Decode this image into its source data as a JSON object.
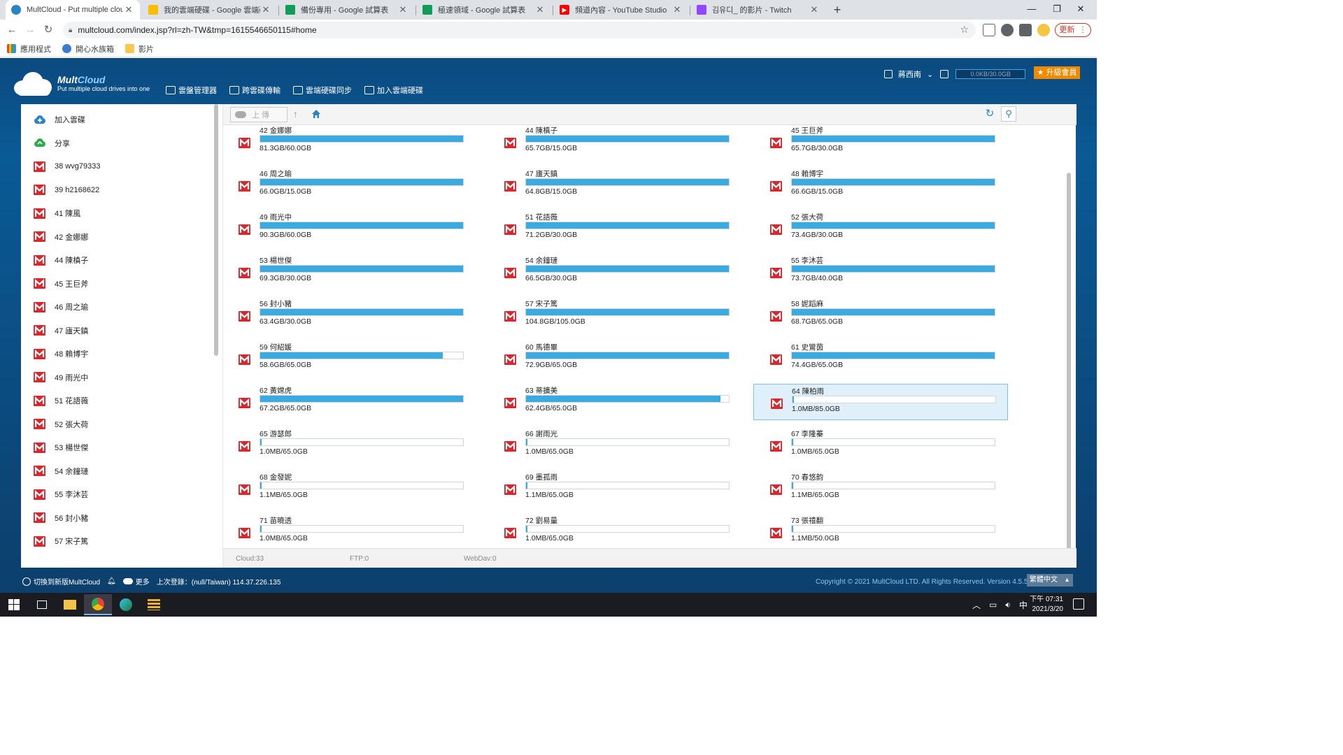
{
  "browser": {
    "tabs": [
      {
        "title": "MultCloud - Put multiple cloud",
        "color": "#2a84c5",
        "active": true
      },
      {
        "title": "我的雲端硬碟 - Google 雲端硬碟",
        "color": "#fbbc04"
      },
      {
        "title": "備份專用 - Google 試算表",
        "color": "#0f9d58"
      },
      {
        "title": "極速領域 - Google 試算表",
        "color": "#0f9d58"
      },
      {
        "title": "頻道內容 - YouTube Studio",
        "color": "#ff0000"
      },
      {
        "title": "김유디_ 的影片 - Twitch",
        "color": "#9146ff"
      }
    ],
    "url": "multcloud.com/index.jsp?rl=zh-TW&tmp=1615546650115#home",
    "update_label": "更新",
    "bookmarks": [
      {
        "label": "應用程式",
        "color": "#4285f4"
      },
      {
        "label": "開心水族箱",
        "color": "#3a7bd5"
      },
      {
        "label": "影片",
        "color": "#f9c74f"
      }
    ]
  },
  "app": {
    "brand_a": "Mult",
    "brand_b": "Cloud",
    "tagline": "Put multiple cloud drives into one",
    "nav": [
      "雲盤管理器",
      "跨雲碟傳輸",
      "雲端硬碟同步",
      "加入雲端硬碟"
    ],
    "user": "蔣西南",
    "quota": "0.0KB/30.0GB",
    "upgrade": "★ 升級會員",
    "toolbar": {
      "upload": "上 傳"
    },
    "sidebar": [
      {
        "label": "加入雲碟",
        "icon": "add-cloud"
      },
      {
        "label": "分享",
        "icon": "share-cloud"
      },
      {
        "label": "38 wvg79333",
        "icon": "mega"
      },
      {
        "label": "39 h2168622",
        "icon": "mega"
      },
      {
        "label": "41 陳風",
        "icon": "mega"
      },
      {
        "label": "42 金娜娜",
        "icon": "mega"
      },
      {
        "label": "44 陳槙子",
        "icon": "mega"
      },
      {
        "label": "45 王巨斧",
        "icon": "mega"
      },
      {
        "label": "46 周之瑜",
        "icon": "mega"
      },
      {
        "label": "47 廬天鎮",
        "icon": "mega"
      },
      {
        "label": "48 賴博宇",
        "icon": "mega"
      },
      {
        "label": "49 雨光中",
        "icon": "mega"
      },
      {
        "label": "51 花語薇",
        "icon": "mega"
      },
      {
        "label": "52 張大荷",
        "icon": "mega"
      },
      {
        "label": "53 楊世傑",
        "icon": "mega"
      },
      {
        "label": "54 余鐘璉",
        "icon": "mega"
      },
      {
        "label": "55 李沐芸",
        "icon": "mega"
      },
      {
        "label": "56 封小豬",
        "icon": "mega"
      },
      {
        "label": "57 宋子篤",
        "icon": "mega"
      }
    ],
    "drives": [
      {
        "name": "42 金娜娜",
        "size": "81.3GB/60.0GB",
        "used": 1.0
      },
      {
        "name": "44 陳槙子",
        "size": "65.7GB/15.0GB",
        "used": 1.0
      },
      {
        "name": "45 王巨斧",
        "size": "65.7GB/30.0GB",
        "used": 1.0
      },
      {
        "name": "46 周之瑜",
        "size": "66.0GB/15.0GB",
        "used": 1.0
      },
      {
        "name": "47 廬天鎮",
        "size": "64.8GB/15.0GB",
        "used": 1.0
      },
      {
        "name": "48 賴博宇",
        "size": "66.6GB/15.0GB",
        "used": 1.0
      },
      {
        "name": "49 雨光中",
        "size": "90.3GB/60.0GB",
        "used": 1.0
      },
      {
        "name": "51 花語薇",
        "size": "71.2GB/30.0GB",
        "used": 1.0
      },
      {
        "name": "52 張大荷",
        "size": "73.4GB/30.0GB",
        "used": 1.0
      },
      {
        "name": "53 楊世傑",
        "size": "69.3GB/30.0GB",
        "used": 1.0
      },
      {
        "name": "54 余鐘璉",
        "size": "66.5GB/30.0GB",
        "used": 1.0
      },
      {
        "name": "55 李沐芸",
        "size": "73.7GB/40.0GB",
        "used": 1.0
      },
      {
        "name": "56 封小豬",
        "size": "63.4GB/30.0GB",
        "used": 1.0
      },
      {
        "name": "57 宋子篤",
        "size": "104.8GB/105.0GB",
        "used": 1.0
      },
      {
        "name": "58 妮蹈麻",
        "size": "68.7GB/65.0GB",
        "used": 1.0
      },
      {
        "name": "59 何紹媛",
        "size": "58.6GB/65.0GB",
        "used": 0.9
      },
      {
        "name": "60 馬德畢",
        "size": "72.9GB/65.0GB",
        "used": 1.0
      },
      {
        "name": "61 史鸞茵",
        "size": "74.4GB/65.0GB",
        "used": 1.0
      },
      {
        "name": "62 黃嫦虎",
        "size": "67.2GB/65.0GB",
        "used": 1.0
      },
      {
        "name": "63 蒂擴美",
        "size": "62.4GB/65.0GB",
        "used": 0.96
      },
      {
        "name": "64 陳柏雨",
        "size": "1.0MB/85.0GB",
        "used": 0.0,
        "selected": true
      },
      {
        "name": "65 游瑟郎",
        "size": "1.0MB/65.0GB",
        "used": 0.0
      },
      {
        "name": "66 謝雨光",
        "size": "1.0MB/65.0GB",
        "used": 0.0
      },
      {
        "name": "67 李隆蓁",
        "size": "1.0MB/65.0GB",
        "used": 0.0
      },
      {
        "name": "68 金發妮",
        "size": "1.1MB/65.0GB",
        "used": 0.0
      },
      {
        "name": "69 墨孤雨",
        "size": "1.1MB/65.0GB",
        "used": 0.0
      },
      {
        "name": "70 春悠韵",
        "size": "1.1MB/65.0GB",
        "used": 0.0
      },
      {
        "name": "71 苗曉透",
        "size": "1.0MB/65.0GB",
        "used": 0.0
      },
      {
        "name": "72 劉易量",
        "size": "1.0MB/65.0GB",
        "used": 0.0
      },
      {
        "name": "73 張禧翻",
        "size": "1.1MB/50.0GB",
        "used": 0.0
      }
    ],
    "status": {
      "cloud": "Cloud:33",
      "ftp": "FTP:0",
      "webdav": "WebDav:0"
    },
    "footer": {
      "switch": "切換到新版MultCloud",
      "more": "更多",
      "last_login": "上次登錄：(null/Taiwan) 114.37.226.135",
      "copyright": "Copyright © 2021 MultCloud LTD. All Rights Reserved. Version 4.5.5",
      "language": "繁體中文"
    }
  },
  "taskbar": {
    "ime": "中",
    "time": "下午 07:31",
    "date": "2021/3/20"
  },
  "colors": {
    "accent": "#3aaae0",
    "mega_red": "#d9272e",
    "header_blue": "#0a5a96",
    "upgrade_orange": "#f08a00"
  }
}
